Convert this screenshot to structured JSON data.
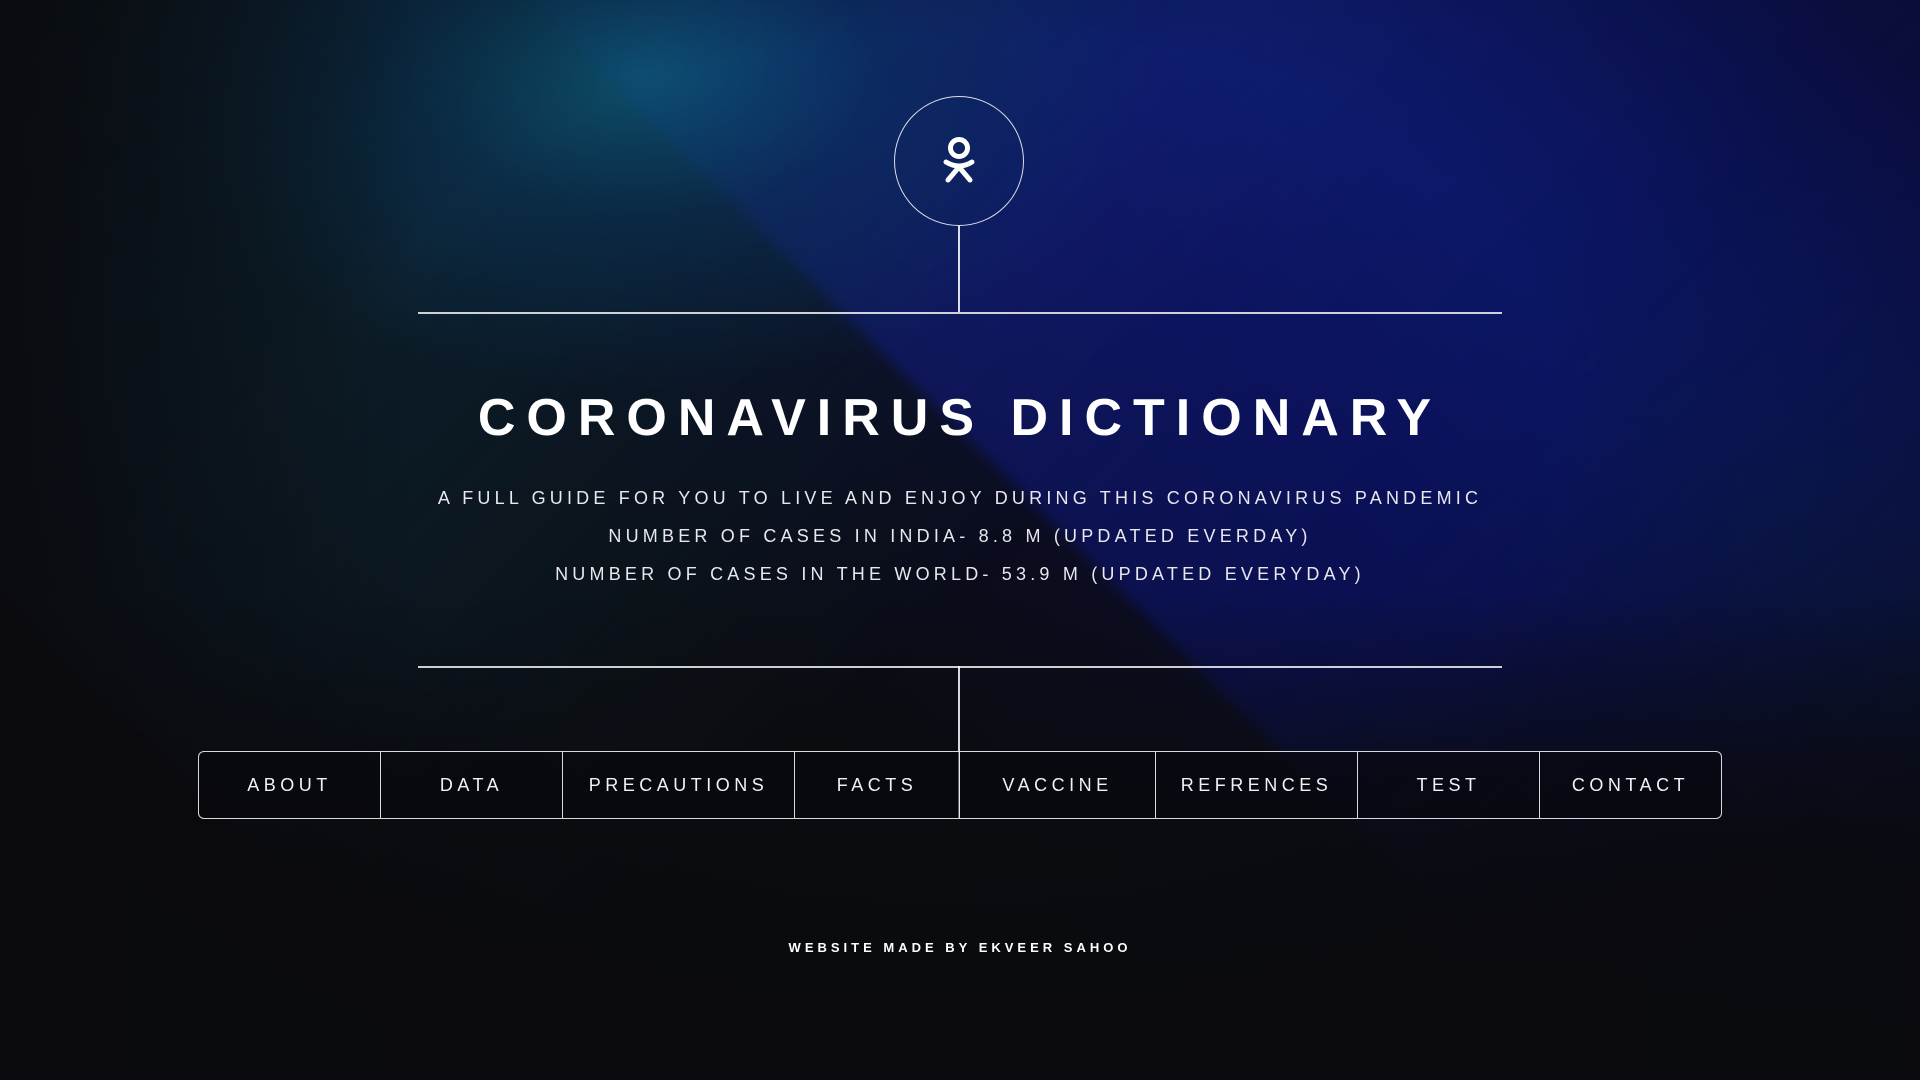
{
  "header": {
    "logo_icon": "odnoklassniki-icon",
    "title": "CORONAVIRUS DICTIONARY",
    "subtitle_lines": [
      "A FULL GUIDE FOR YOU TO LIVE AND ENJOY DURING THIS CORONAVIRUS PANDEMIC",
      "NUMBER OF CASES IN INDIA- 8.8 M (UPDATED EVERDAY)",
      "NUMBER OF CASES IN THE WORLD- 53.9 M (UPDATED EVERYDAY)"
    ]
  },
  "nav": {
    "items": [
      {
        "label": "ABOUT"
      },
      {
        "label": "DATA"
      },
      {
        "label": "PRECAUTIONS"
      },
      {
        "label": "FACTS"
      },
      {
        "label": "VACCINE"
      },
      {
        "label": "REFRENCES"
      },
      {
        "label": "TEST"
      },
      {
        "label": "CONTACT"
      }
    ]
  },
  "footer": {
    "credit": "WEBSITE MADE BY EKVEER SAHOO"
  },
  "colors": {
    "background": "#0b0c10",
    "accent_blue": "#0d1480",
    "accent_teal": "#0f7882",
    "text": "#ffffff"
  }
}
